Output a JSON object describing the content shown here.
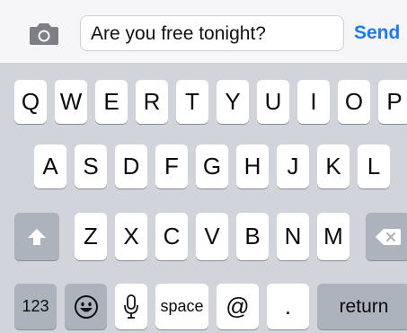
{
  "composer": {
    "message": "Are you free tonight?",
    "send_label": "Send",
    "camera_icon": "camera-icon"
  },
  "keyboard": {
    "row1": [
      "Q",
      "W",
      "E",
      "R",
      "T",
      "Y",
      "U",
      "I",
      "O",
      "P"
    ],
    "row2": [
      "A",
      "S",
      "D",
      "F",
      "G",
      "H",
      "J",
      "K",
      "L"
    ],
    "row3": [
      "Z",
      "X",
      "C",
      "V",
      "B",
      "N",
      "M"
    ],
    "shift_icon": "shift-icon",
    "delete_icon": "delete-icon",
    "numbers_label": "123",
    "emoji_icon": "emoji-icon",
    "mic_icon": "microphone-icon",
    "space_label": "space",
    "at_label": "@",
    "period_label": ".",
    "return_label": "return"
  },
  "colors": {
    "send": "#1a7af8",
    "keyboard_bg": "#d1d5db",
    "key": "#ffffff",
    "special_key": "#adb3bc"
  }
}
